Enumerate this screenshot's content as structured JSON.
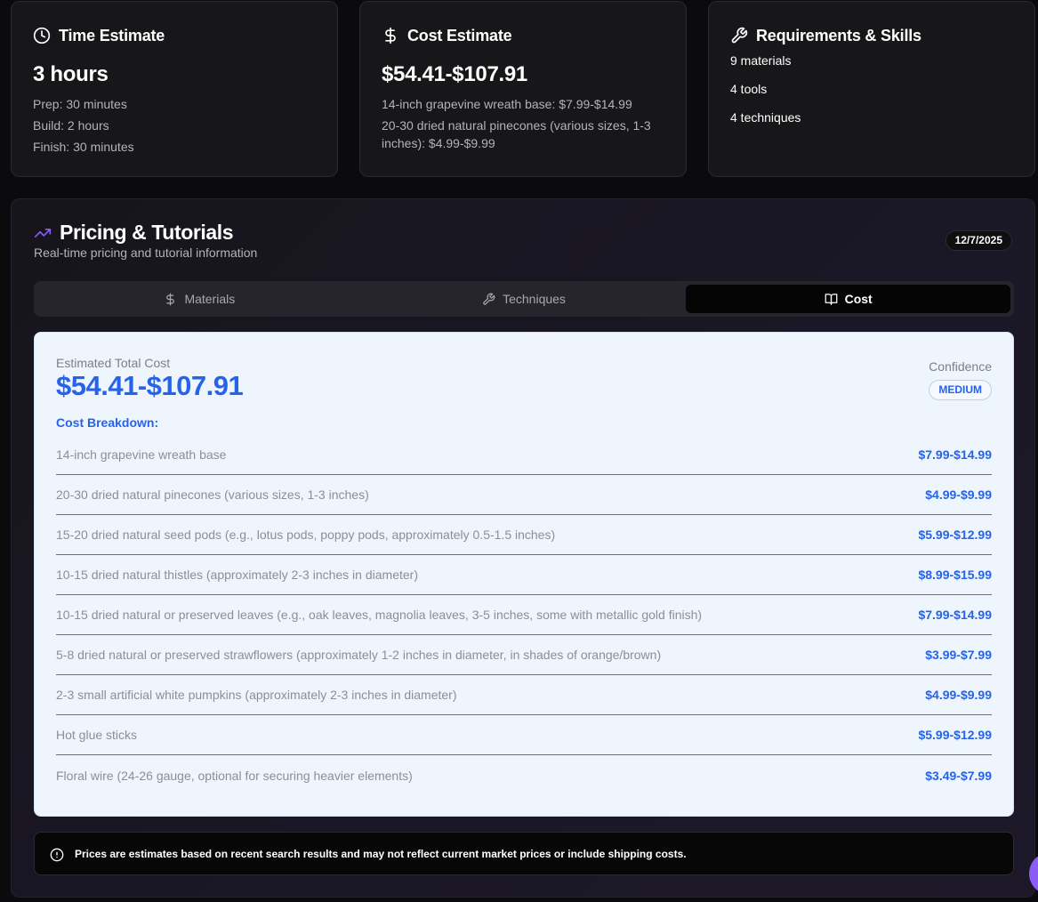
{
  "time_card": {
    "title": "Time Estimate",
    "icon": "clock-icon",
    "total": "3 hours",
    "lines": [
      "Prep: 30 minutes",
      "Build: 2 hours",
      "Finish: 30 minutes"
    ]
  },
  "cost_card": {
    "title": "Cost Estimate",
    "icon": "dollar-icon",
    "total": "$54.41-$107.91",
    "lines": [
      "14-inch grapevine wreath base: $7.99-$14.99",
      "20-30 dried natural pinecones (various sizes, 1-3 inches): $4.99-$9.99"
    ]
  },
  "req_card": {
    "title": "Requirements & Skills",
    "icon": "wrench-icon",
    "items": [
      "9 materials",
      "4 tools",
      "4 techniques"
    ]
  },
  "panel": {
    "title": "Pricing & Tutorials",
    "icon": "trending-up-icon",
    "subtitle": "Real-time pricing and tutorial information",
    "date": "12/7/2025",
    "tabs": [
      {
        "label": "Materials",
        "icon": "dollar-icon",
        "active": false
      },
      {
        "label": "Techniques",
        "icon": "wrench-icon",
        "active": false
      },
      {
        "label": "Cost",
        "icon": "book-open-icon",
        "active": true
      }
    ],
    "cost": {
      "estimate_label": "Estimated Total Cost",
      "estimate_value": "$54.41-$107.91",
      "confidence_label": "Confidence",
      "confidence_value": "MEDIUM",
      "breakdown_title": "Cost Breakdown:",
      "items": [
        {
          "name": "14-inch grapevine wreath base",
          "price": "$7.99-$14.99"
        },
        {
          "name": "20-30 dried natural pinecones (various sizes, 1-3 inches)",
          "price": "$4.99-$9.99"
        },
        {
          "name": "15-20 dried natural seed pods (e.g., lotus pods, poppy pods, approximately 0.5-1.5 inches)",
          "price": "$5.99-$12.99"
        },
        {
          "name": "10-15 dried natural thistles (approximately 2-3 inches in diameter)",
          "price": "$8.99-$15.99"
        },
        {
          "name": "10-15 dried natural or preserved leaves (e.g., oak leaves, magnolia leaves, 3-5 inches, some with metallic gold finish)",
          "price": "$7.99-$14.99"
        },
        {
          "name": "5-8 dried natural or preserved strawflowers (approximately 1-2 inches in diameter, in shades of orange/brown)",
          "price": "$3.99-$7.99"
        },
        {
          "name": "2-3 small artificial white pumpkins (approximately 2-3 inches in diameter)",
          "price": "$4.99-$9.99"
        },
        {
          "name": "Hot glue sticks",
          "price": "$5.99-$12.99"
        },
        {
          "name": "Floral wire (24-26 gauge, optional for securing heavier elements)",
          "price": "$3.49-$7.99"
        }
      ]
    },
    "notice": {
      "icon": "alert-circle-icon",
      "text": "Prices are estimates based on recent search results and may not reflect current market prices or include shipping costs."
    }
  },
  "colors": {
    "accent_blue": "#2563eb",
    "accent_purple": "#8b5cf6",
    "background": "#0b0b0d"
  }
}
